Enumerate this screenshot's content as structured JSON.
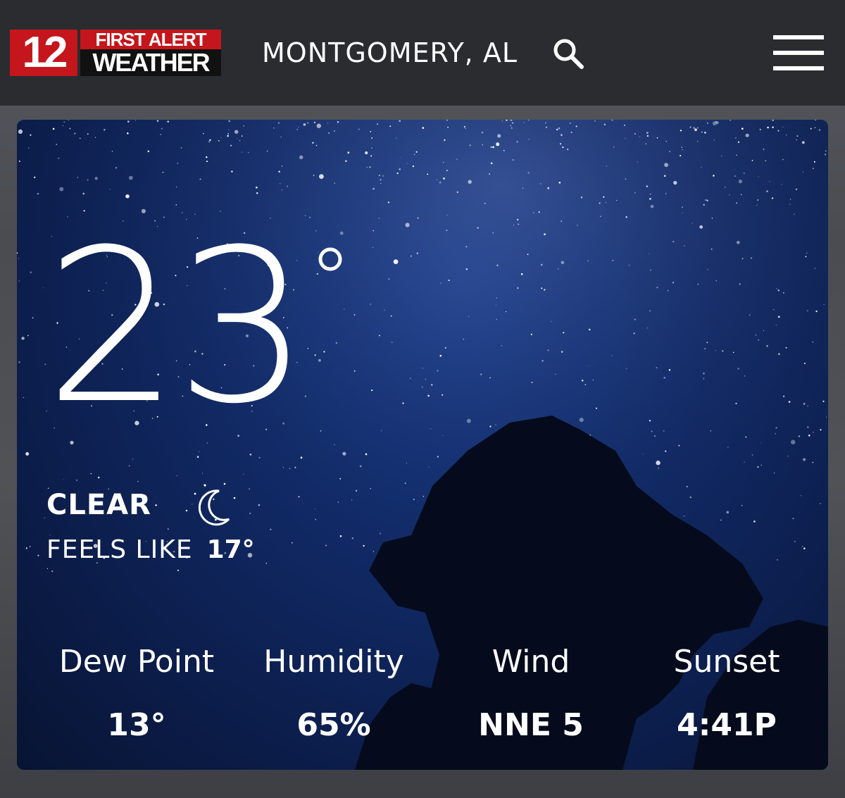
{
  "header": {
    "logo": {
      "number": "12",
      "line1": "FIRST ALERT",
      "line2": "WEATHER"
    },
    "location": "MONTGOMERY, AL",
    "icons": {
      "search": "search-icon",
      "menu": "hamburger-menu-icon"
    }
  },
  "current": {
    "temperature": "23",
    "condition": "CLEAR",
    "condition_icon": "moon-icon",
    "feels_like_label": "FEELS LIKE",
    "feels_like_value": "17°"
  },
  "stats": [
    {
      "label": "Dew Point",
      "value": "13°"
    },
    {
      "label": "Humidity",
      "value": "65%"
    },
    {
      "label": "Wind",
      "value": "NNE 5"
    },
    {
      "label": "Sunset",
      "value": "4:41P"
    }
  ],
  "colors": {
    "brand_red": "#c4161c",
    "header_bg": "#2b2c30",
    "sky_blue": "#112a66",
    "text": "#ffffff"
  }
}
